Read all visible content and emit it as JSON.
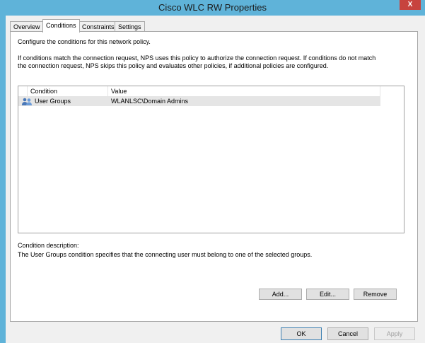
{
  "window": {
    "title": "Cisco WLC RW Properties",
    "close_label": "X"
  },
  "tabs": [
    {
      "label": "Overview"
    },
    {
      "label": "Conditions"
    },
    {
      "label": "Constraints"
    },
    {
      "label": "Settings"
    }
  ],
  "active_tab": "Conditions",
  "panel": {
    "intro": "Configure the conditions for this network policy.",
    "description": "If conditions match the connection request, NPS uses this policy to authorize the connection request. If conditions do not match the connection request, NPS skips this policy and evaluates other policies, if additional policies are configured."
  },
  "list": {
    "columns": [
      "Condition",
      "Value"
    ],
    "rows": [
      {
        "icon": "user-group-icon",
        "condition": "User Groups",
        "value": "WLANLSC\\Domain Admins"
      }
    ]
  },
  "condition_description": {
    "label": "Condition description:",
    "text": "The User Groups condition specifies that the connecting user must belong to one of the selected groups."
  },
  "buttons": {
    "add": "Add...",
    "edit": "Edit...",
    "remove": "Remove",
    "ok": "OK",
    "cancel": "Cancel",
    "apply": "Apply"
  }
}
